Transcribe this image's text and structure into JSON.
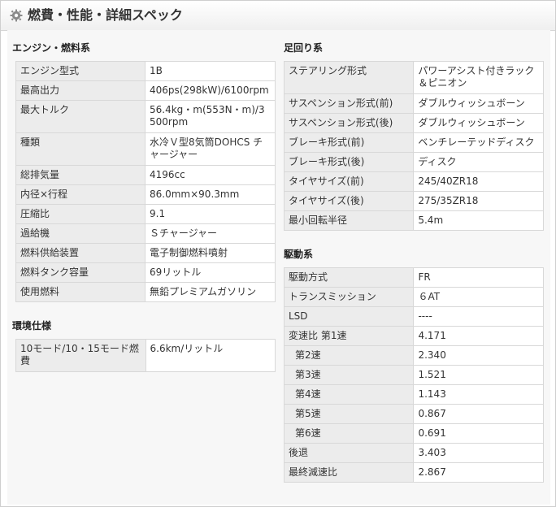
{
  "header": {
    "title": "燃費・性能・詳細スペック",
    "icon": "gear-icon"
  },
  "colors": {
    "label_bg": "#ececec",
    "value_bg": "#ffffff",
    "border": "#d8d8d8",
    "panel_bg": "#f7f7f7"
  },
  "left": {
    "engine": {
      "title": "エンジン・燃料系",
      "rows": [
        {
          "label": "エンジン型式",
          "value": "1B"
        },
        {
          "label": "最高出力",
          "value": "406ps(298kW)/6100rpm"
        },
        {
          "label": "最大トルク",
          "value": "56.4kg・m(553N・m)/3500rpm"
        },
        {
          "label": "種類",
          "value": "水冷Ｖ型8気筒DOHCS チャージャー"
        },
        {
          "label": "総排気量",
          "value": "4196cc"
        },
        {
          "label": "内径×行程",
          "value": "86.0mm×90.3mm"
        },
        {
          "label": "圧縮比",
          "value": "9.1"
        },
        {
          "label": "過給機",
          "value": "Ｓチャージャー"
        },
        {
          "label": "燃料供給装置",
          "value": "電子制御燃料噴射"
        },
        {
          "label": "燃料タンク容量",
          "value": "69リットル"
        },
        {
          "label": "使用燃料",
          "value": "無鉛プレミアムガソリン"
        }
      ]
    },
    "environment": {
      "title": "環境仕様",
      "rows": [
        {
          "label": "10モード/10・15モード燃費",
          "value": "6.6km/リットル"
        }
      ]
    }
  },
  "right": {
    "suspension": {
      "title": "足回り系",
      "rows": [
        {
          "label": "ステアリング形式",
          "value": "パワーアシスト付きラック＆ピニオン"
        },
        {
          "label": "サスペンション形式(前)",
          "value": "ダブルウィッシュボーン"
        },
        {
          "label": "サスペンション形式(後)",
          "value": "ダブルウィッシュボーン"
        },
        {
          "label": "ブレーキ形式(前)",
          "value": "ベンチレーテッドディスク"
        },
        {
          "label": "ブレーキ形式(後)",
          "value": "ディスク"
        },
        {
          "label": "タイヤサイズ(前)",
          "value": "245/40ZR18"
        },
        {
          "label": "タイヤサイズ(後)",
          "value": "275/35ZR18"
        },
        {
          "label": "最小回転半径",
          "value": "5.4m"
        }
      ]
    },
    "drivetrain": {
      "title": "駆動系",
      "rows": [
        {
          "label": "駆動方式",
          "value": "FR"
        },
        {
          "label": "トランスミッション",
          "value": "６AT"
        },
        {
          "label": "LSD",
          "value": "----"
        },
        {
          "label": "変速比 第1速",
          "value": "4.171"
        },
        {
          "label": "第2速",
          "value": "2.340"
        },
        {
          "label": "第3速",
          "value": "1.521"
        },
        {
          "label": "第4速",
          "value": "1.143"
        },
        {
          "label": "第5速",
          "value": "0.867"
        },
        {
          "label": "第6速",
          "value": "0.691"
        },
        {
          "label": "後退",
          "value": "3.403"
        },
        {
          "label": "最終減速比",
          "value": "2.867"
        }
      ]
    }
  }
}
